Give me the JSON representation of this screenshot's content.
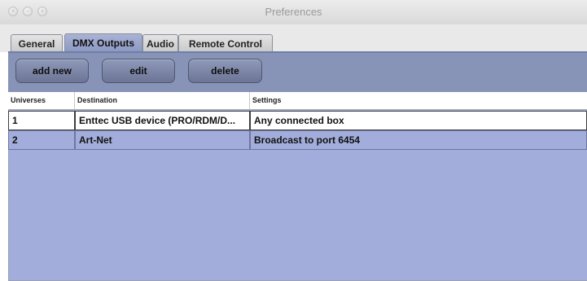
{
  "window": {
    "title": "Preferences"
  },
  "tabs": [
    {
      "label": "General",
      "selected": false
    },
    {
      "label": "DMX Outputs",
      "selected": true
    },
    {
      "label": "Audio",
      "selected": false
    },
    {
      "label": "Remote Control",
      "selected": false
    }
  ],
  "toolbar": {
    "add_label": "add new",
    "edit_label": "edit",
    "delete_label": "delete"
  },
  "table": {
    "columns": [
      "Universes",
      "Destination",
      "Settings"
    ],
    "rows": [
      {
        "universe": "1",
        "destination": "Enttec USB device (PRO/RDM/D...",
        "settings": "Any connected box",
        "selected": true
      },
      {
        "universe": "2",
        "destination": "Art-Net",
        "settings": "Broadcast to port 6454",
        "selected": false
      }
    ]
  },
  "colors": {
    "panel": "#a2addb",
    "toolbar": "#8893b8",
    "selected_tab": "#8d98c2"
  }
}
